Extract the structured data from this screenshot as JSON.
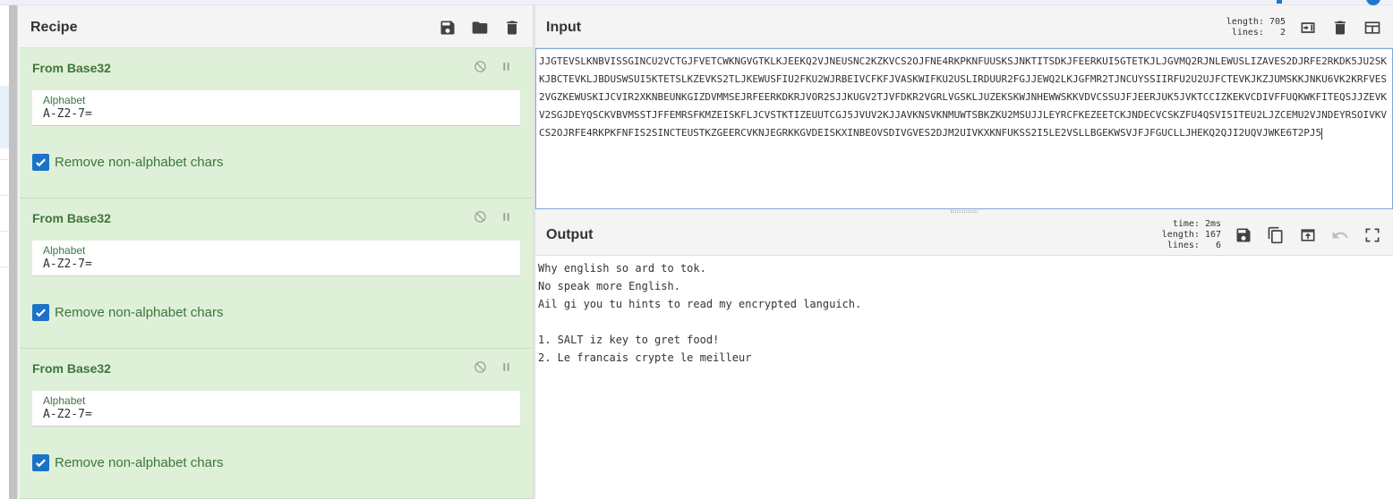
{
  "recipe": {
    "title": "Recipe",
    "header_icons": [
      "save-icon",
      "folder-icon",
      "trash-icon"
    ],
    "operations": [
      {
        "name": "From Base32",
        "controls": [
          "disable-icon",
          "pause-icon"
        ],
        "alphabet_label": "Alphabet",
        "alphabet_value": "A-Z2-7=",
        "remove_label": "Remove non-alphabet chars",
        "remove_checked": true
      },
      {
        "name": "From Base32",
        "controls": [
          "disable-icon",
          "pause-icon"
        ],
        "alphabet_label": "Alphabet",
        "alphabet_value": "A-Z2-7=",
        "remove_label": "Remove non-alphabet chars",
        "remove_checked": true
      },
      {
        "name": "From Base32",
        "controls": [
          "disable-icon",
          "pause-icon"
        ],
        "alphabet_label": "Alphabet",
        "alphabet_value": "A-Z2-7=",
        "remove_label": "Remove non-alphabet chars",
        "remove_checked": true
      }
    ]
  },
  "input": {
    "title": "Input",
    "length_label": "length:",
    "length_value": "705",
    "lines_label": "lines:",
    "lines_value": "2",
    "header_icons": [
      "insert-tab-icon",
      "trash-icon",
      "layout-icon"
    ],
    "text": "JJGTEVSLKNBVISSGINCU2VCTGJFVETCWKNGVGTKLKJEEKQ2VJNEUSNC2KZKVCS2OJFNE4RKPKNFUUSKSJNKTITSDKJFEERKUI5GTETKJLJGVMQ2RJNLEWUSLIZAVES2DJRFE2RKDK5JU2SKKJBCTEVKLJBDUSWSUI5KTETSLKZEVKS2TLJKEWUSFIU2FKU2WJRBEIVCFKFJVASKWIFKU2USLIRDUUR2FGJJEWQ2LKJGFMR2TJNCUYSSIIRFU2U2UJFCTEVKJKZJUMSKKJNKU6VK2KRFVES2VGZKEWUSKIJCVIR2XKNBEUNKGIZDVMMSEJRFEERKDKRJVOR2SJJKUGV2TJVFDKR2VGRLVGSKLJUZEKSKWJNHEWWSKKVDVCSSUJFJEERJUK5JVKTCCIZKEKVCDIVFFUQKWKFITEQSJJZEVKV2SGJDEYQSCKVBVMSSTJFFEMRSFKMZEISKFLJCVSTKTIZEUUTCGJ5JVUV2KJJAVKNSVKNMUWTSBKZKU2MSUJJLEYRCFKEZEETCKJNDECVCSKZFU4QSVI5ITEU2LJZCEMU2VJNDEYRSOIVKVCS2OJRFE4RKPKFNFIS2SINCTEUSTKZGEERCVKNJEGRKKGVDEISKXINBEOVSDIVGVES2DJM2UIVKXKNFUKSS2I5LE2VSLLBGEKWSVJFJFGUCLLJHEKQ2QJI2UQVJWKE6T2PJ5"
  },
  "output": {
    "title": "Output",
    "time_label": "time:",
    "time_value": "2ms",
    "length_label": "length:",
    "length_value": "167",
    "lines_label": "lines:",
    "lines_value": "6",
    "header_icons": [
      "save-icon",
      "copy-icon",
      "replace-input-icon",
      "undo-icon",
      "maximise-icon"
    ],
    "text": "Why english so ard to tok.\nNo speak more English.\nAil gi you tu hints to read my encrypted languich.\n\n1. SALT iz key to gret food!\n2. Le francais crypte le meilleur"
  },
  "colors": {
    "recipe_bg": "#dff0d8",
    "op_title": "#3c763d",
    "checkbox": "#1a73c8",
    "accent": "#1e76d2"
  }
}
